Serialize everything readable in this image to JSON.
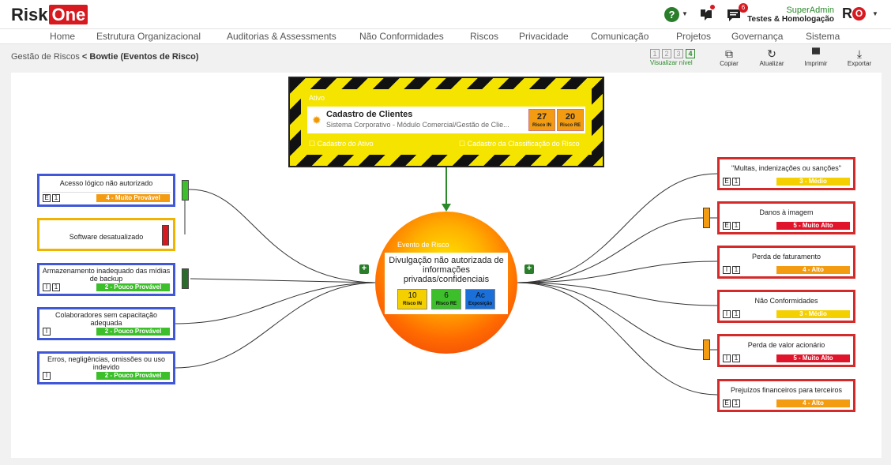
{
  "app": {
    "logo_risk": "Risk",
    "logo_one": "One"
  },
  "header": {
    "help_icon": "?",
    "chat_badge": "6",
    "user_name": "SuperAdmin",
    "user_env": "Testes & Homologação",
    "avatar_r": "R",
    "avatar_o": "O"
  },
  "nav": [
    "Home",
    "Estrutura Organizacional",
    "Auditorias & Assessments",
    "Não Conformidades",
    "Riscos",
    "Privacidade",
    "Comunicação",
    "Projetos",
    "Governança",
    "Sistema"
  ],
  "breadcrumb": {
    "parent": "Gestão de Riscos",
    "sep": "<",
    "current": "Bowtie (Eventos de Risco)"
  },
  "toolbar": {
    "levels": [
      "1",
      "2",
      "3",
      "4"
    ],
    "level_label": "Visualizar nível",
    "copy": "Copiar",
    "refresh": "Atualizar",
    "print": "Imprimir",
    "export": "Exportar"
  },
  "asset": {
    "label": "Ativo",
    "name": "Cadastro de Clientes",
    "subtitle": "Sistema Corporativo - Módulo Comercial/Gestão de Clie...",
    "risk_in": "27",
    "risk_in_label": "Risco IN",
    "risk_re": "20",
    "risk_re_label": "Risco RE",
    "link_asset": "Cadastro do Ativo",
    "link_class": "Cadastro da Classificação do Risco"
  },
  "event": {
    "label": "Evento de Risco",
    "title": "Divulgação não autorizada de informações privadas/confidenciais",
    "risk_in": "10",
    "risk_in_label": "Risco IN",
    "risk_re": "6",
    "risk_re_label": "Risco RE",
    "exposure": "Ac",
    "exposure_label": "Exposição"
  },
  "causes": [
    {
      "text": "Acesso lógico não autorizado",
      "tags": [
        "E",
        "1"
      ],
      "prob": "4 - Muito Provável",
      "color": "#f39c12"
    },
    {
      "text": "Software desatualizado",
      "tags": [],
      "prob": "",
      "color": ""
    },
    {
      "text": "Armazenamento inadequado das mídias de backup",
      "tags": [
        "I",
        "1"
      ],
      "prob": "2 - Pouco Provável",
      "color": "#3cbf2a"
    },
    {
      "text": "Colaboradores sem capacitação adequada",
      "tags": [
        "I"
      ],
      "prob": "2 - Pouco Provável",
      "color": "#3cbf2a"
    },
    {
      "text": "Erros, negligências, omissões ou uso indevido",
      "tags": [
        "I"
      ],
      "prob": "2 - Pouco Provável",
      "color": "#3cbf2a"
    }
  ],
  "consequences": [
    {
      "text": "\"Multas, indenizações ou sanções\"",
      "tags": [
        "E",
        "1"
      ],
      "impact": "3 - Médio",
      "color": "#f5d000"
    },
    {
      "text": "Danos à imagem",
      "tags": [
        "E",
        "1"
      ],
      "impact": "5 - Muito Alto",
      "color": "#e0142a"
    },
    {
      "text": "Perda de faturamento",
      "tags": [
        "I",
        "1"
      ],
      "impact": "4 - Alto",
      "color": "#f39c12"
    },
    {
      "text": "Não Conformidades",
      "tags": [
        "I",
        "1"
      ],
      "impact": "3 - Médio",
      "color": "#f5d000"
    },
    {
      "text": "Perda de valor acionário",
      "tags": [
        "I",
        "1"
      ],
      "impact": "5 - Muito Alto",
      "color": "#e0142a"
    },
    {
      "text": "Prejuízos financeiros para terceiros",
      "tags": [
        "E",
        "1"
      ],
      "impact": "4 - Alto",
      "color": "#f39c12"
    }
  ],
  "colors": {
    "brand": "#d71920",
    "accent": "#2a8a2a",
    "cause_border": "#4058d8",
    "consequence_border": "#d42a2a"
  },
  "icons": {
    "copy": "copy-icon",
    "refresh": "refresh-icon",
    "print": "printer-icon",
    "export": "download-icon",
    "gear": "gear-icon"
  }
}
